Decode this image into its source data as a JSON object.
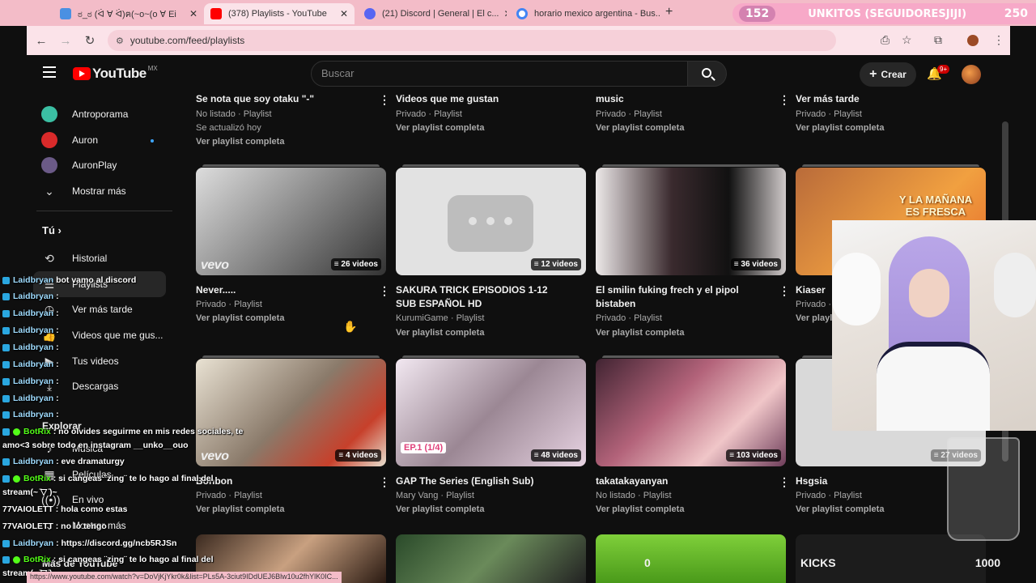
{
  "browser": {
    "tabs": [
      {
        "title": "ಠ_ಠ (ᐛ ∀ ᐛ)ฅ(~o~(o ∀ Ei",
        "color": "#4a90e2"
      },
      {
        "title": "(378) Playlists - YouTube",
        "color": "#ff0000"
      },
      {
        "title": "(21) Discord | General | El c...",
        "color": "#5865f2"
      },
      {
        "title": "horario mexico argentina - Bus...",
        "color": "#4285f4"
      }
    ],
    "url": "youtube.com/feed/playlists",
    "status_url": "https://www.youtube.com/watch?v=DoVjKjYkr0k&list=PLs5A-3ciut9IDdUEJ6Blw10u2fhYlK0IC..."
  },
  "stream_overlay": {
    "left_count": "152",
    "title": "UNKITOS (SEGUIDORESJIJI)",
    "right_count": "250",
    "bottom_left_value": "0",
    "kicks_label": "KICKS",
    "kicks_value": "1000"
  },
  "masthead": {
    "logo": "YouTube",
    "country": "MX",
    "search_placeholder": "Buscar",
    "create_label": "Crear",
    "notif_count": "9+"
  },
  "sidebar": {
    "top_items": [
      {
        "label": "Antroporama",
        "color": "#3bbfa3"
      },
      {
        "label": "Auron",
        "color": "#d92a2a"
      },
      {
        "label": "AuronPlay",
        "color": "#6b5a87"
      }
    ],
    "more_label": "Mostrar más",
    "you_label": "Tú",
    "you_items": [
      {
        "label": "Historial",
        "icon": "history-icon"
      },
      {
        "label": "Playlists",
        "icon": "playlist-icon"
      },
      {
        "label": "Ver más tarde",
        "icon": "clock-icon"
      },
      {
        "label": "Videos que me gus...",
        "icon": "thumb-up-icon"
      },
      {
        "label": "Tus videos",
        "icon": "video-icon"
      },
      {
        "label": "Descargas",
        "icon": "download-icon"
      }
    ],
    "explore_label": "Explorar",
    "explore_items": [
      {
        "label": "Música",
        "icon": "music-icon"
      },
      {
        "label": "Películas",
        "icon": "film-icon"
      },
      {
        "label": "En vivo",
        "icon": "live-icon"
      },
      {
        "label": "Mostrar más",
        "icon": "chevron-down-icon"
      }
    ],
    "more_from": "Más de YouTube"
  },
  "playlists_top": [
    {
      "title": "Se nota que soy otaku \"-\"",
      "meta": "No listado · Playlist",
      "extra": "Se actualizó hoy",
      "link": "Ver playlist completa"
    },
    {
      "title": "Videos que me gustan",
      "meta": "Privado · Playlist",
      "link": "Ver playlist completa"
    },
    {
      "title": "music",
      "meta": "Privado · Playlist",
      "link": "Ver playlist completa"
    },
    {
      "title": "Ver más tarde",
      "meta": "Privado · Playlist",
      "link": "Ver playlist completa"
    }
  ],
  "playlists_mid": [
    {
      "title": "Never.....",
      "meta": "Privado · Playlist",
      "link": "Ver playlist completa",
      "count": "26 videos",
      "vevo": true,
      "bg": "linear-gradient(135deg,#ddd,#777 60%,#333)"
    },
    {
      "title": "SAKURA TRICK EPISODIOS 1-12 SUB ESPAÑOL HD",
      "meta": "KurumiGame · Playlist",
      "link": "Ver playlist completa",
      "count": "12 videos",
      "vevo": false,
      "bg": "#e2e2e2"
    },
    {
      "title": "El smilin fuking frech y el pipol bistaben",
      "meta": "Privado · Playlist",
      "link": "Ver playlist completa",
      "count": "36 videos",
      "vevo": false,
      "bg": "linear-gradient(90deg,#ece8e8,#3a2a2e 40%,#111 70%,#cfc9c9)"
    },
    {
      "title": "Kiaser",
      "meta": "Privado · Playlist",
      "link": "Ver playl",
      "count": "",
      "vevo": false,
      "bg": "linear-gradient(135deg,#b96b3a,#f1a040 60%,#e46a2a)",
      "caption": "Y LA MAÑANA ES FRESCA"
    }
  ],
  "playlists_bottom": [
    {
      "title": "Bonbon",
      "meta": "Privado · Playlist",
      "link": "Ver playlist completa",
      "count": "4 videos",
      "vevo": true,
      "bg": "linear-gradient(135deg,#e9e2d3,#8a7a6a 50%,#c7402b 80%,#e8e0d0)"
    },
    {
      "title": "GAP The Series (English Sub)",
      "meta": "Mary Vang · Playlist",
      "link": "Ver playlist completa",
      "count": "48 videos",
      "vevo": false,
      "bg": "linear-gradient(135deg,#f2e8f1,#9b8794 50%,#e7d3e2)",
      "caption": "EP.1 (1/4)"
    },
    {
      "title": "takatakayanyan",
      "meta": "No listado · Playlist",
      "link": "Ver playlist completa",
      "count": "103 videos",
      "vevo": false,
      "bg": "linear-gradient(135deg,#412432,#b3637a 40%,#f0c6c8 70%,#6e3d5a)"
    },
    {
      "title": "Hsgsia",
      "meta": "Privado · Playlist",
      "link": "Ver playlist completa",
      "count": "27 videos",
      "vevo": false,
      "bg": "#d9d9d9"
    }
  ],
  "chat": [
    {
      "user": "Laidbryan",
      "text": "bot vamo al discord",
      "kind": "user"
    },
    {
      "user": "Laidbryan",
      "text": ":",
      "kind": "user"
    },
    {
      "user": "Laidbryan",
      "text": ":",
      "kind": "user"
    },
    {
      "user": "Laidbryan",
      "text": ":",
      "kind": "user"
    },
    {
      "user": "Laidbryan",
      "text": ":",
      "kind": "user"
    },
    {
      "user": "Laidbryan",
      "text": ":",
      "kind": "user"
    },
    {
      "user": "Laidbryan",
      "text": ":",
      "kind": "user"
    },
    {
      "user": "Laidbryan",
      "text": ":",
      "kind": "user"
    },
    {
      "user": "Laidbryan",
      "text": ":",
      "kind": "user"
    },
    {
      "user": "BotRix",
      "text": ": no olvides seguirme en mis redes sociales, te",
      "kind": "bot"
    },
    {
      "user": "",
      "text": "amo<3 sobre todo en instagram __unko__ouo",
      "kind": "cont"
    },
    {
      "user": "Laidbryan",
      "text": ": eve dramaturgy",
      "kind": "user"
    },
    {
      "user": "BotRix",
      "text": ": si cangeas ¨zing¨ te lo hago al final del",
      "kind": "bot"
    },
    {
      "user": "",
      "text": "stream(~ ̄▽ ̄)~",
      "kind": "cont"
    },
    {
      "user": "77VAIOLETT",
      "text": ": hola como estas",
      "kind": "plain"
    },
    {
      "user": "77VAIOLETT",
      "text": ": no lo tengo",
      "kind": "plain"
    },
    {
      "user": "Laidbryan",
      "text": ": https://discord.gg/ncb5RJSn",
      "kind": "user"
    },
    {
      "user": "BotRix",
      "text": ": si cangeas ¨zing¨ te lo hago al final del",
      "kind": "bot"
    },
    {
      "user": "",
      "text": "stream(~ ̄▽ ̄)~",
      "kind": "cont"
    }
  ]
}
